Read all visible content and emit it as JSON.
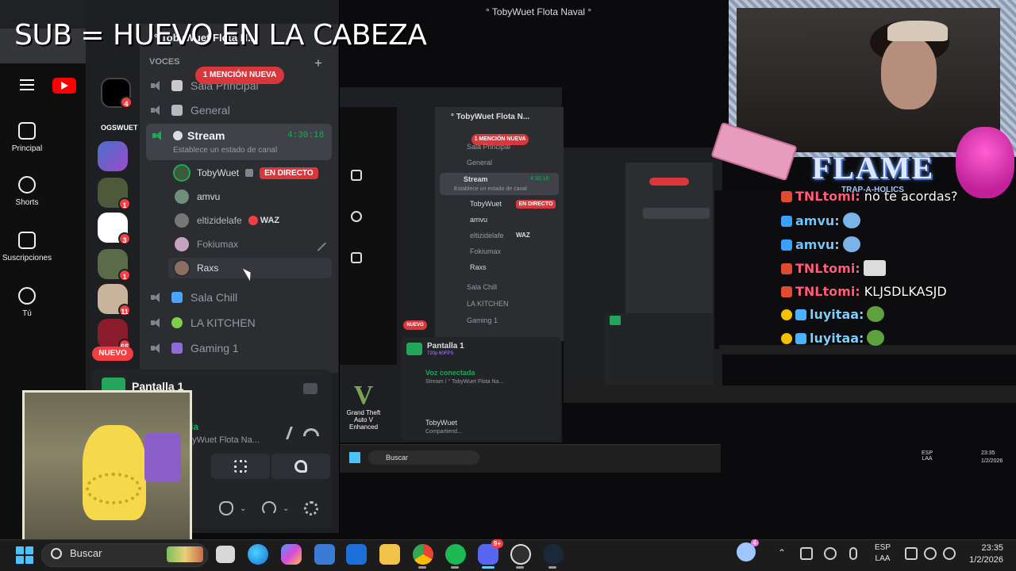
{
  "overlay": {
    "sub_text": "SUB = HUEVO EN LA CABEZA"
  },
  "window": {
    "title": "° TobyWuet Flota Naval °"
  },
  "youtube": {
    "nav": [
      {
        "label": "Principal",
        "icon": "home-icon"
      },
      {
        "label": "Shorts",
        "icon": "shorts-icon"
      },
      {
        "label": "Suscripciones",
        "icon": "subscriptions-icon"
      },
      {
        "label": "Tú",
        "icon": "account-icon"
      }
    ]
  },
  "discord": {
    "server_name": "° TobyWuet Flota N...",
    "category": "VOCES",
    "mention_pill": "1 MENCIÓN NUEVA",
    "new_pill": "NUEVO",
    "server_badges": [
      "4",
      "1",
      "3",
      "1",
      "11",
      "66"
    ],
    "channels": [
      {
        "name": "Sala Principal"
      },
      {
        "name": "General"
      },
      {
        "name": "Stream",
        "time": "4:30:18",
        "status": "Establece un estado de canal"
      },
      {
        "name": "Sala Chill"
      },
      {
        "name": "LA KITCHEN"
      },
      {
        "name": "Gaming 1"
      }
    ],
    "members": [
      {
        "name": "TobyWuet",
        "badge": "EN DIRECTO"
      },
      {
        "name": "amvu"
      },
      {
        "name": "eltizidelafe",
        "tag": "WAZ"
      },
      {
        "name": "Fokiumax"
      },
      {
        "name": "Raxs"
      }
    ],
    "voice_panel": {
      "title": "Pantalla 1",
      "status_partial": "da",
      "channel_partial": "byWuet Flota Na..."
    }
  },
  "nested": {
    "server_name": "° TobyWuet Flota N...",
    "mention_pill": "1 MENCIÓN NUEVA",
    "channels": [
      "Sala Principal",
      "General",
      "Stream",
      "Sala Chill",
      "LA KITCHEN",
      "Gaming 1"
    ],
    "stream_time": "4:30:18",
    "stream_status": "Establece un estado de canal",
    "members": [
      "TobyWuet",
      "amvu",
      "eltizidelafe",
      "Fokiumax",
      "Raxs"
    ],
    "live_badge": "EN DIRECTO",
    "waz": "WAZ",
    "pantalla": "Pantalla 1",
    "pantalla_sub": "720p 60FPS",
    "voz": "Voz conectada",
    "voz_sub": "Stream / ° TobyWuet Flota Na...",
    "user": "TobyWuet",
    "user_sub": "Compartiend...",
    "gta": "Grand Theft Auto V Enhanced",
    "search": "Buscar",
    "lang": "ESP LAA",
    "time": "23:35",
    "date": "1/2/2026",
    "nuevo": "NUEVO"
  },
  "webcam": {
    "logo": "FLAME",
    "logo_sub": "TRAP-A-HOLICS"
  },
  "chat": [
    {
      "user": "TNLtomi:",
      "text": "no te acordas?",
      "color": "#ff5c7a"
    },
    {
      "user": "amvu:",
      "text": "",
      "color": "#6cc6ff"
    },
    {
      "user": "amvu:",
      "text": "",
      "color": "#6cc6ff"
    },
    {
      "user": "TNLtomi:",
      "text": "",
      "color": "#ff5c7a"
    },
    {
      "user": "TNLtomi:",
      "text": "KLJSDLKASJD",
      "color": "#ff5c7a"
    },
    {
      "user": "luyitaa:",
      "text": "",
      "color": "#7ad0ff"
    },
    {
      "user": "luyitaa:",
      "text": "",
      "color": "#7ad0ff"
    }
  ],
  "taskbar": {
    "search_placeholder": "Buscar",
    "discord_badge": "9+",
    "lang_line1": "ESP",
    "lang_line2": "LAA",
    "time": "23:35",
    "date": "1/2/2026",
    "apps": [
      "file-explorer",
      "edge",
      "copilot",
      "store",
      "outlook",
      "folder",
      "chrome",
      "spotify",
      "discord",
      "obs",
      "steam"
    ]
  },
  "colors": {
    "discord_bg": "#1e1f22",
    "channel_bg": "#2b2d31",
    "accent_red": "#da373c",
    "accent_green": "#23a55a",
    "taskbar": "#1c1c1c"
  }
}
